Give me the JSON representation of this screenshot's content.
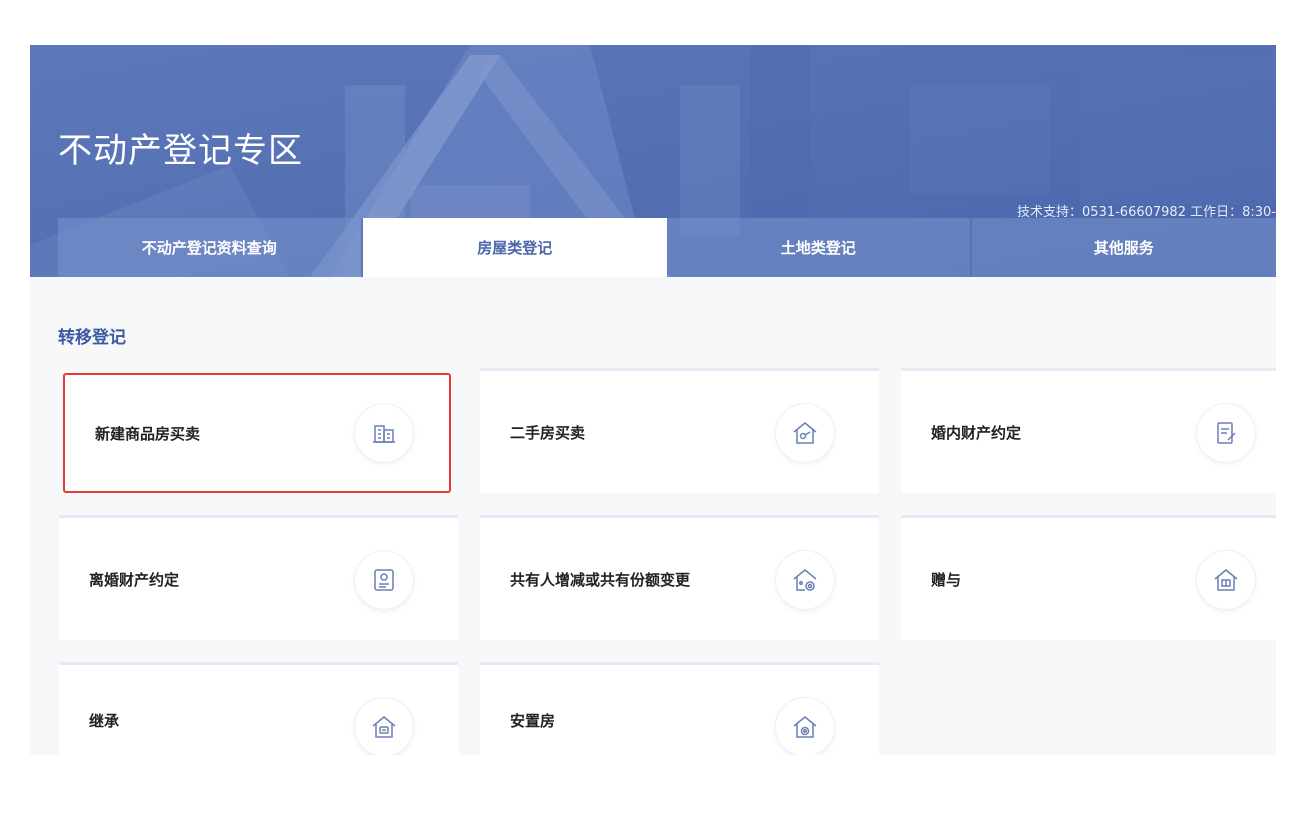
{
  "header": {
    "title": "不动产登记专区",
    "support_text": "技术支持：0531-66607982 工作日：8:30-"
  },
  "tabs": [
    {
      "label": "不动产登记资料查询"
    },
    {
      "label": "房屋类登记"
    },
    {
      "label": "土地类登记"
    },
    {
      "label": "其他服务"
    }
  ],
  "active_tab": "房屋类登记",
  "section": {
    "title": "转移登记"
  },
  "cards": [
    {
      "label": "新建商品房买卖",
      "icon": "building-icon"
    },
    {
      "label": "二手房买卖",
      "icon": "house-key-icon"
    },
    {
      "label": "婚内财产约定",
      "icon": "document-pen-icon"
    },
    {
      "label": "离婚财产约定",
      "icon": "certificate-icon"
    },
    {
      "label": "共有人增减或共有份额变更",
      "icon": "house-share-icon"
    },
    {
      "label": "赠与",
      "icon": "house-gift-icon"
    },
    {
      "label": "继承",
      "icon": "house-inherit-icon"
    },
    {
      "label": "安置房",
      "icon": "house-resettle-icon"
    }
  ],
  "selected_card": "新建商品房买卖",
  "colors": {
    "banner": "#5a74b6",
    "accent": "#4b66aa",
    "section_title": "#3d5aa0",
    "selected_border": "#e53935"
  }
}
